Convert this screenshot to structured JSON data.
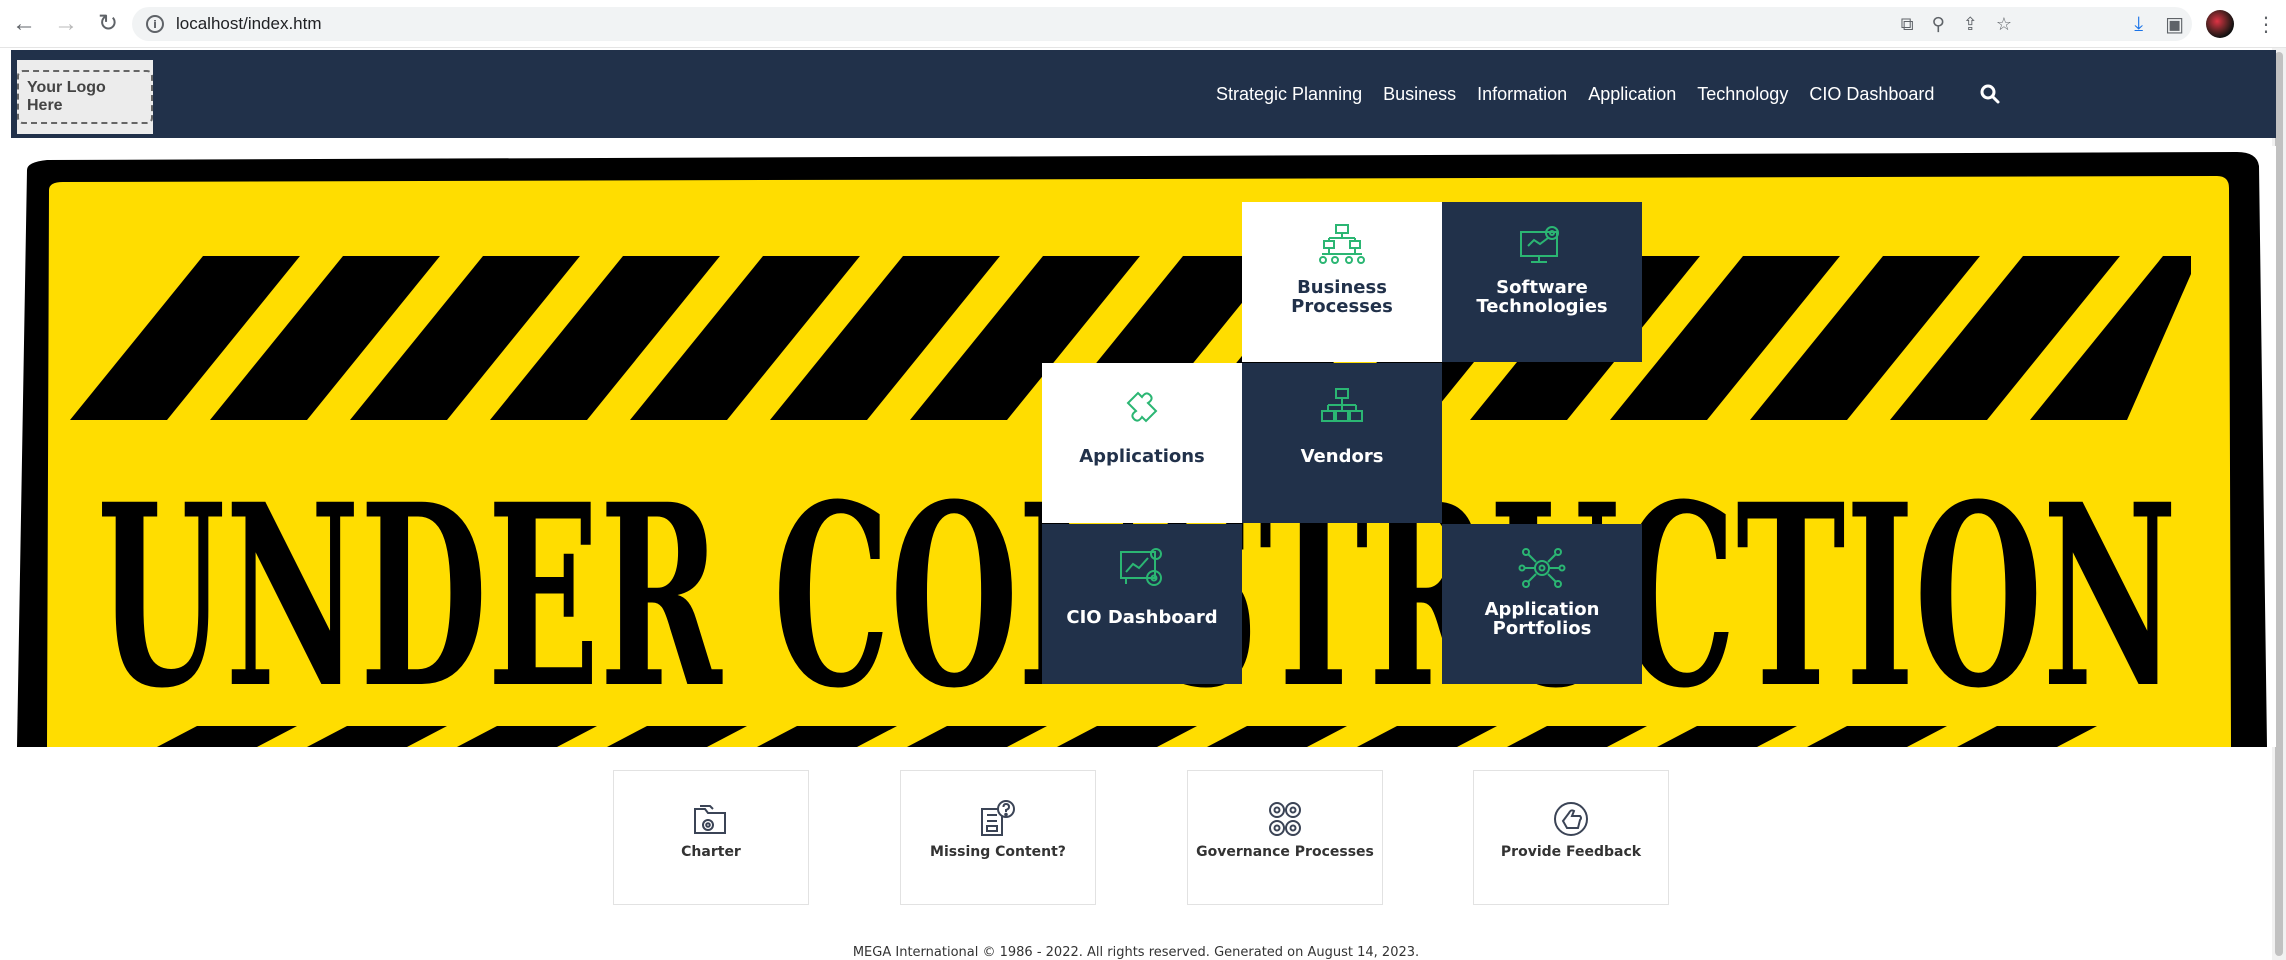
{
  "browser": {
    "url": "localhost/index.htm"
  },
  "site": {
    "logo_text": "Your Logo Here",
    "nav": [
      {
        "label": "Strategic Planning"
      },
      {
        "label": "Business"
      },
      {
        "label": "Information"
      },
      {
        "label": "Application"
      },
      {
        "label": "Technology"
      },
      {
        "label": "CIO Dashboard"
      }
    ],
    "colors": {
      "header": "#21314a",
      "accent": "#2bb673",
      "banner_yellow": "#ffdd00"
    }
  },
  "banner": {
    "text": "UNDER CONSTRUCTION"
  },
  "tiles": {
    "business_processes": {
      "label": "Business Processes",
      "icon": "hierarchy-icon"
    },
    "software_technologies": {
      "label": "Software Technologies",
      "icon": "monitor-gear-icon"
    },
    "applications": {
      "label": "Applications",
      "icon": "puzzle-icon"
    },
    "vendors": {
      "label": "Vendors",
      "icon": "org-chart-icon"
    },
    "cio_dashboard": {
      "label": "CIO Dashboard",
      "icon": "dashboard-icon"
    },
    "application_portfolios": {
      "label": "Application Portfolios",
      "icon": "network-gear-icon"
    }
  },
  "cards": {
    "charter": {
      "label": "Charter"
    },
    "missing_content": {
      "label": "Missing Content?"
    },
    "governance": {
      "label": "Governance Processes"
    },
    "feedback": {
      "label": "Provide Feedback"
    }
  },
  "footer": {
    "text": "MEGA International © 1986 - 2022. All rights reserved. Generated on August 14, 2023."
  }
}
